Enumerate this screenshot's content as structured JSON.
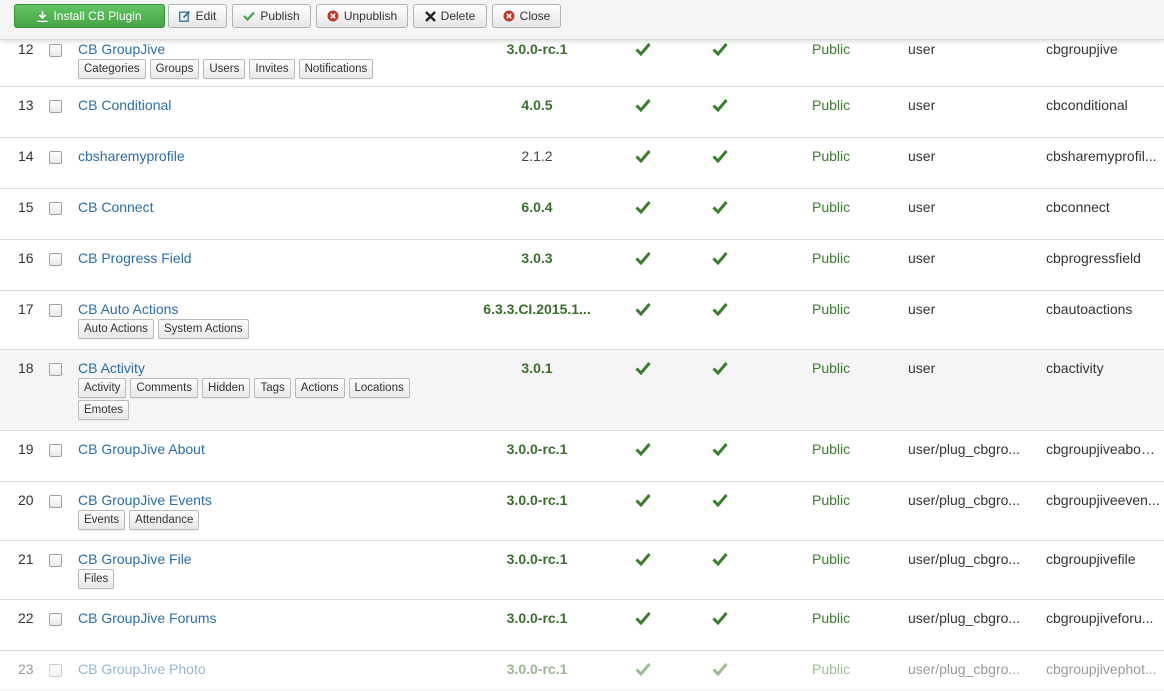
{
  "toolbar": {
    "install": "Install CB Plugin",
    "edit": "Edit",
    "publish": "Publish",
    "unpublish": "Unpublish",
    "delete": "Delete",
    "close": "Close"
  },
  "colors": {
    "link": "#2a6ea8",
    "check": "#3a7d2c",
    "success": "#46a546",
    "danger": "#c0392b"
  },
  "rows": [
    {
      "id": "12",
      "name": "CB GroupJive",
      "version": "3.0.0-rc.1",
      "access": "Public",
      "folder": "user",
      "element": "cbgroupjive",
      "tags": [
        "Categories",
        "Groups",
        "Users",
        "Invites",
        "Notifications"
      ]
    },
    {
      "id": "13",
      "name": "CB Conditional",
      "version": "4.0.5",
      "access": "Public",
      "folder": "user",
      "element": "cbconditional",
      "tags": []
    },
    {
      "id": "14",
      "name": "cbsharemyprofile",
      "version": "2.1.2",
      "access": "Public",
      "folder": "user",
      "element": "cbsharemyprofil...",
      "tags": []
    },
    {
      "id": "15",
      "name": "CB Connect",
      "version": "6.0.4",
      "access": "Public",
      "folder": "user",
      "element": "cbconnect",
      "tags": []
    },
    {
      "id": "16",
      "name": "CB Progress Field",
      "version": "3.0.3",
      "access": "Public",
      "folder": "user",
      "element": "cbprogressfield",
      "tags": []
    },
    {
      "id": "17",
      "name": "CB Auto Actions",
      "version": "6.3.3.CI.2015.1...",
      "access": "Public",
      "folder": "user",
      "element": "cbautoactions",
      "tags": [
        "Auto Actions",
        "System Actions"
      ]
    },
    {
      "id": "18",
      "name": "CB Activity",
      "version": "3.0.1",
      "access": "Public",
      "folder": "user",
      "element": "cbactivity",
      "tags": [
        "Activity",
        "Comments",
        "Hidden",
        "Tags",
        "Actions",
        "Locations",
        "Emotes"
      ]
    },
    {
      "id": "19",
      "name": "CB GroupJive About",
      "version": "3.0.0-rc.1",
      "access": "Public",
      "folder": "user/plug_cbgro...",
      "element": "cbgroupjiveabou...",
      "tags": []
    },
    {
      "id": "20",
      "name": "CB GroupJive Events",
      "version": "3.0.0-rc.1",
      "access": "Public",
      "folder": "user/plug_cbgro...",
      "element": "cbgroupjiveeven...",
      "tags": [
        "Events",
        "Attendance"
      ]
    },
    {
      "id": "21",
      "name": "CB GroupJive File",
      "version": "3.0.0-rc.1",
      "access": "Public",
      "folder": "user/plug_cbgro...",
      "element": "cbgroupjivefile",
      "tags": [
        "Files"
      ]
    },
    {
      "id": "22",
      "name": "CB GroupJive Forums",
      "version": "3.0.0-rc.1",
      "access": "Public",
      "folder": "user/plug_cbgro...",
      "element": "cbgroupjiveforu...",
      "tags": []
    },
    {
      "id": "23",
      "name": "CB GroupJive Photo",
      "version": "3.0.0-rc.1",
      "access": "Public",
      "folder": "user/plug_cbgro...",
      "element": "cbgroupjivephot...",
      "tags": []
    }
  ]
}
